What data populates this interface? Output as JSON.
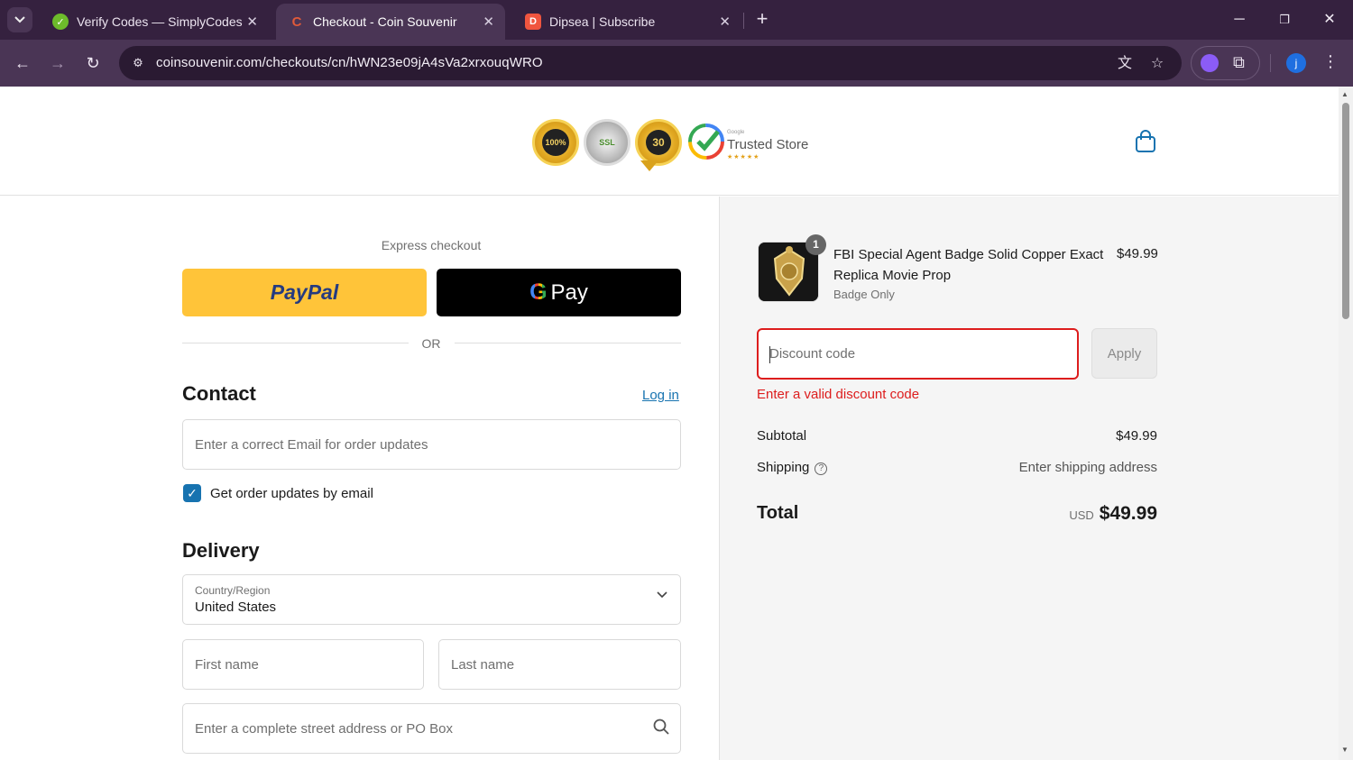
{
  "browser": {
    "tabs": [
      {
        "title": "Verify Codes — SimplyCodes",
        "active": false
      },
      {
        "title": "Checkout - Coin Souvenir",
        "active": true
      },
      {
        "title": "Dipsea | Subscribe",
        "active": false
      }
    ],
    "url": "coinsouvenir.com/checkouts/cn/hWN23e09jA4sVa2xrxouqWRO",
    "profile_initial": "j"
  },
  "header": {
    "trust_seal_1": "100%",
    "trust_seal_2": "SSL",
    "trust_seal_3": "30",
    "trusted_store_small": "Google",
    "trusted_store": "Trusted Store",
    "trusted_stars": "★★★★★"
  },
  "checkout": {
    "express_label": "Express checkout",
    "paypal_label": "PayPal",
    "gpay_label": "Pay",
    "or_label": "OR",
    "contact_heading": "Contact",
    "login_label": "Log in",
    "email_placeholder": "Enter a correct Email for order updates",
    "updates_label": "Get order updates by email",
    "delivery_heading": "Delivery",
    "country_label": "Country/Region",
    "country_value": "United States",
    "first_name_placeholder": "First name",
    "last_name_placeholder": "Last name",
    "address_placeholder": "Enter a complete street address or PO Box"
  },
  "summary": {
    "product_title": "FBI Special Agent Badge Solid Copper Exact Replica Movie Prop",
    "product_variant": "Badge Only",
    "product_price": "$49.99",
    "quantity": "1",
    "discount_placeholder": "Discount code",
    "apply_label": "Apply",
    "discount_error": "Enter a valid discount code",
    "subtotal_label": "Subtotal",
    "subtotal_value": "$49.99",
    "shipping_label": "Shipping",
    "shipping_value": "Enter shipping address",
    "total_label": "Total",
    "currency": "USD",
    "total_value": "$49.99"
  },
  "colors": {
    "accent": "#1773b0",
    "error": "#dd1d1d",
    "paypal": "#ffc439",
    "chrome": "#35213f"
  }
}
